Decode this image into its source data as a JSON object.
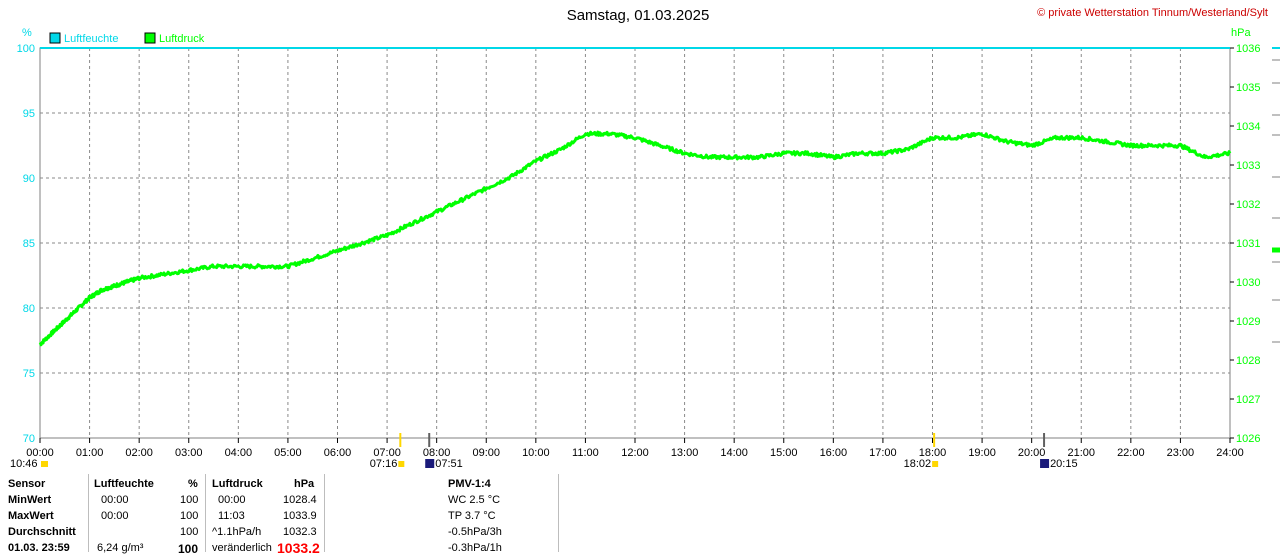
{
  "header": {
    "title": "Samstag, 01.03.2025",
    "copyright": "© private Wetterstation Tinnum/Westerland/Sylt"
  },
  "colors": {
    "humidity": "#00d8e8",
    "pressure": "#00ff00",
    "copyright": "#cc0000",
    "sun": "#ffd700",
    "moon": "#1a1a7a",
    "highlight": "#ff0000"
  },
  "chart_data": {
    "type": "line",
    "legend_position": "top-left",
    "grid": true,
    "x_ticks": [
      "00:00",
      "01:00",
      "02:00",
      "03:00",
      "04:00",
      "05:00",
      "06:00",
      "07:00",
      "08:00",
      "09:00",
      "10:00",
      "11:00",
      "12:00",
      "13:00",
      "14:00",
      "15:00",
      "16:00",
      "17:00",
      "18:00",
      "19:00",
      "20:00",
      "21:00",
      "22:00",
      "23:00",
      "24:00"
    ],
    "xlim": [
      0,
      24
    ],
    "left_axis": {
      "unit": "%",
      "range": [
        70,
        100
      ],
      "ticks": [
        "70",
        "75",
        "80",
        "85",
        "90",
        "95",
        "100"
      ]
    },
    "right_axis": {
      "unit": "hPa",
      "range": [
        1026,
        1036
      ],
      "ticks": [
        "1026",
        "1027",
        "1028",
        "1029",
        "1030",
        "1031",
        "1032",
        "1033",
        "1034",
        "1035",
        "1036"
      ]
    },
    "series": [
      {
        "name": "Luftfeuchte",
        "axis": "left",
        "x": [
          0,
          24
        ],
        "y": [
          100,
          100
        ]
      },
      {
        "name": "Luftdruck",
        "axis": "right",
        "x": [
          0,
          0.25,
          0.5,
          0.75,
          1.0,
          1.25,
          1.5,
          1.75,
          2.0,
          2.5,
          3.0,
          3.5,
          4.0,
          4.5,
          5.0,
          5.5,
          6.0,
          6.5,
          7.0,
          7.5,
          8.0,
          8.5,
          9.0,
          9.5,
          10.0,
          10.5,
          11.0,
          11.5,
          12.0,
          12.5,
          13.0,
          13.5,
          14.0,
          14.5,
          15.0,
          15.5,
          16.0,
          16.5,
          17.0,
          17.5,
          18.0,
          18.5,
          19.0,
          19.5,
          20.0,
          20.5,
          21.0,
          21.5,
          22.0,
          22.5,
          23.0,
          23.5,
          24.0
        ],
        "y": [
          1028.4,
          1028.7,
          1029.0,
          1029.3,
          1029.6,
          1029.8,
          1029.9,
          1030.0,
          1030.1,
          1030.2,
          1030.3,
          1030.4,
          1030.4,
          1030.4,
          1030.4,
          1030.6,
          1030.8,
          1031.0,
          1031.2,
          1031.5,
          1031.8,
          1032.1,
          1032.4,
          1032.7,
          1033.1,
          1033.4,
          1033.8,
          1033.8,
          1033.7,
          1033.5,
          1033.3,
          1033.2,
          1033.2,
          1033.2,
          1033.3,
          1033.3,
          1033.2,
          1033.3,
          1033.3,
          1033.4,
          1033.7,
          1033.7,
          1033.8,
          1033.6,
          1033.5,
          1033.7,
          1033.7,
          1033.6,
          1033.5,
          1033.5,
          1033.5,
          1033.2,
          1033.3
        ]
      }
    ],
    "sun_events": [
      {
        "label": "07:16",
        "time": 7.267
      },
      {
        "label": "18:02",
        "time": 18.033
      }
    ],
    "moon_events": [
      {
        "label": "07:51",
        "time": 7.85
      },
      {
        "label": "20:15",
        "time": 20.25
      }
    ],
    "start_label": "10:46"
  },
  "table": {
    "sensor_header": "Sensor",
    "rows": [
      "MinWert",
      "MaxWert",
      "Durchschnitt",
      "01.03. 23:59"
    ],
    "hum_header": "Luftfeuchte",
    "hum_unit": "%",
    "hum_times": [
      "00:00",
      "00:00",
      "",
      "6,24 g/m³"
    ],
    "hum_values": [
      "100",
      "100",
      "100",
      "100"
    ],
    "press_header": "Luftdruck",
    "press_unit": "hPa",
    "press_times": [
      "00:00",
      "11:03",
      "^1.1hPa/h",
      "veränderlich"
    ],
    "press_values": [
      "1028.4",
      "1033.9",
      "1032.3",
      "1033.2"
    ],
    "pmv_header": "PMV-1:4",
    "pmv_lines": [
      "WC 2.5 °C",
      "TP 3.7 °C",
      "-0.5hPa/3h",
      "-0.3hPa/1h"
    ]
  }
}
